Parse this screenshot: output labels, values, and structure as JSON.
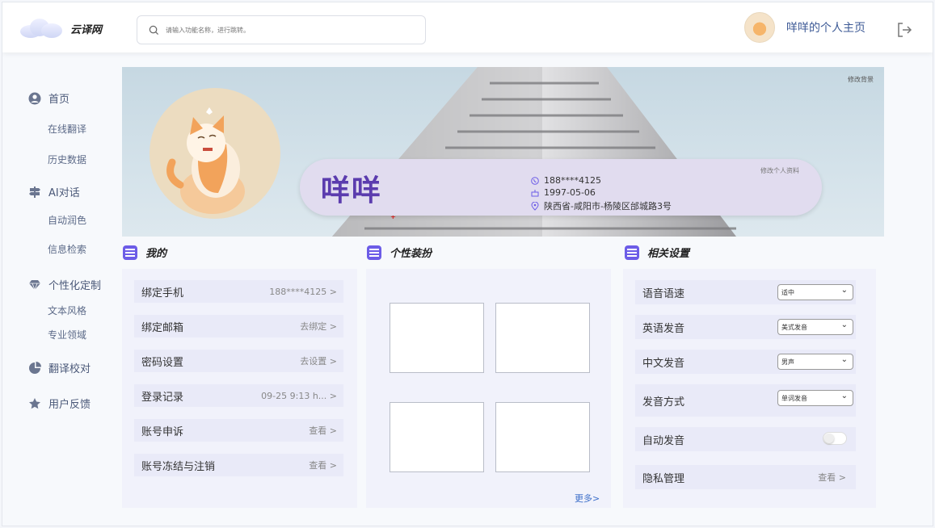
{
  "header": {
    "logo_text": "云译网",
    "search_placeholder": "请输入功能名称，进行跳转。",
    "user_name": "咩咩的个人主页"
  },
  "sidebar": {
    "items": [
      {
        "label": "首页",
        "icon": "user-circle-icon"
      },
      {
        "label": "在线翻译"
      },
      {
        "label": "历史数据"
      },
      {
        "label": "AI对话",
        "icon": "signpost-icon"
      },
      {
        "label": "自动润色"
      },
      {
        "label": "信息检索"
      },
      {
        "label": "个性化定制",
        "icon": "diamond-icon"
      },
      {
        "label": "文本风格"
      },
      {
        "label": "专业领域"
      },
      {
        "label": "翻译校对",
        "icon": "pie-chart-icon"
      },
      {
        "label": "用户反馈",
        "icon": "star-icon"
      }
    ]
  },
  "banner": {
    "edit_bg": "修改背景",
    "name": "咩咩",
    "phone": "188****4125",
    "birthday": "1997-05-06",
    "address": "陕西省-咸阳市-杨陵区邰城路3号",
    "edit_profile": "修改个人资料",
    "gender_symbol": "♀"
  },
  "sections": {
    "mine": {
      "title": "我的",
      "rows": [
        {
          "label": "绑定手机",
          "value": "188****4125  >"
        },
        {
          "label": "绑定邮箱",
          "value": "去绑定  >"
        },
        {
          "label": "密码设置",
          "value": "去设置  >"
        },
        {
          "label": "登录记录",
          "value": "09-25 9:13 h...  >"
        },
        {
          "label": "账号申诉",
          "value": "查看  >"
        },
        {
          "label": "账号冻结与注销",
          "value": "查看  >"
        }
      ]
    },
    "dress": {
      "title": "个性装扮",
      "more": "更多>"
    },
    "settings": {
      "title": "相关设置",
      "rows": [
        {
          "label": "语音语速",
          "select": "适中"
        },
        {
          "label": "英语发音",
          "select": "美式发音"
        },
        {
          "label": "中文发音",
          "select": "男声"
        },
        {
          "label": "发音方式",
          "select": "单词发音"
        },
        {
          "label": "自动发音",
          "toggle": false
        },
        {
          "label": "隐私管理",
          "value": "查看  >"
        }
      ]
    }
  },
  "colors": {
    "accent": "#6c5ce7",
    "name_purple": "#5b3cae",
    "link_blue": "#3d6fc9"
  }
}
